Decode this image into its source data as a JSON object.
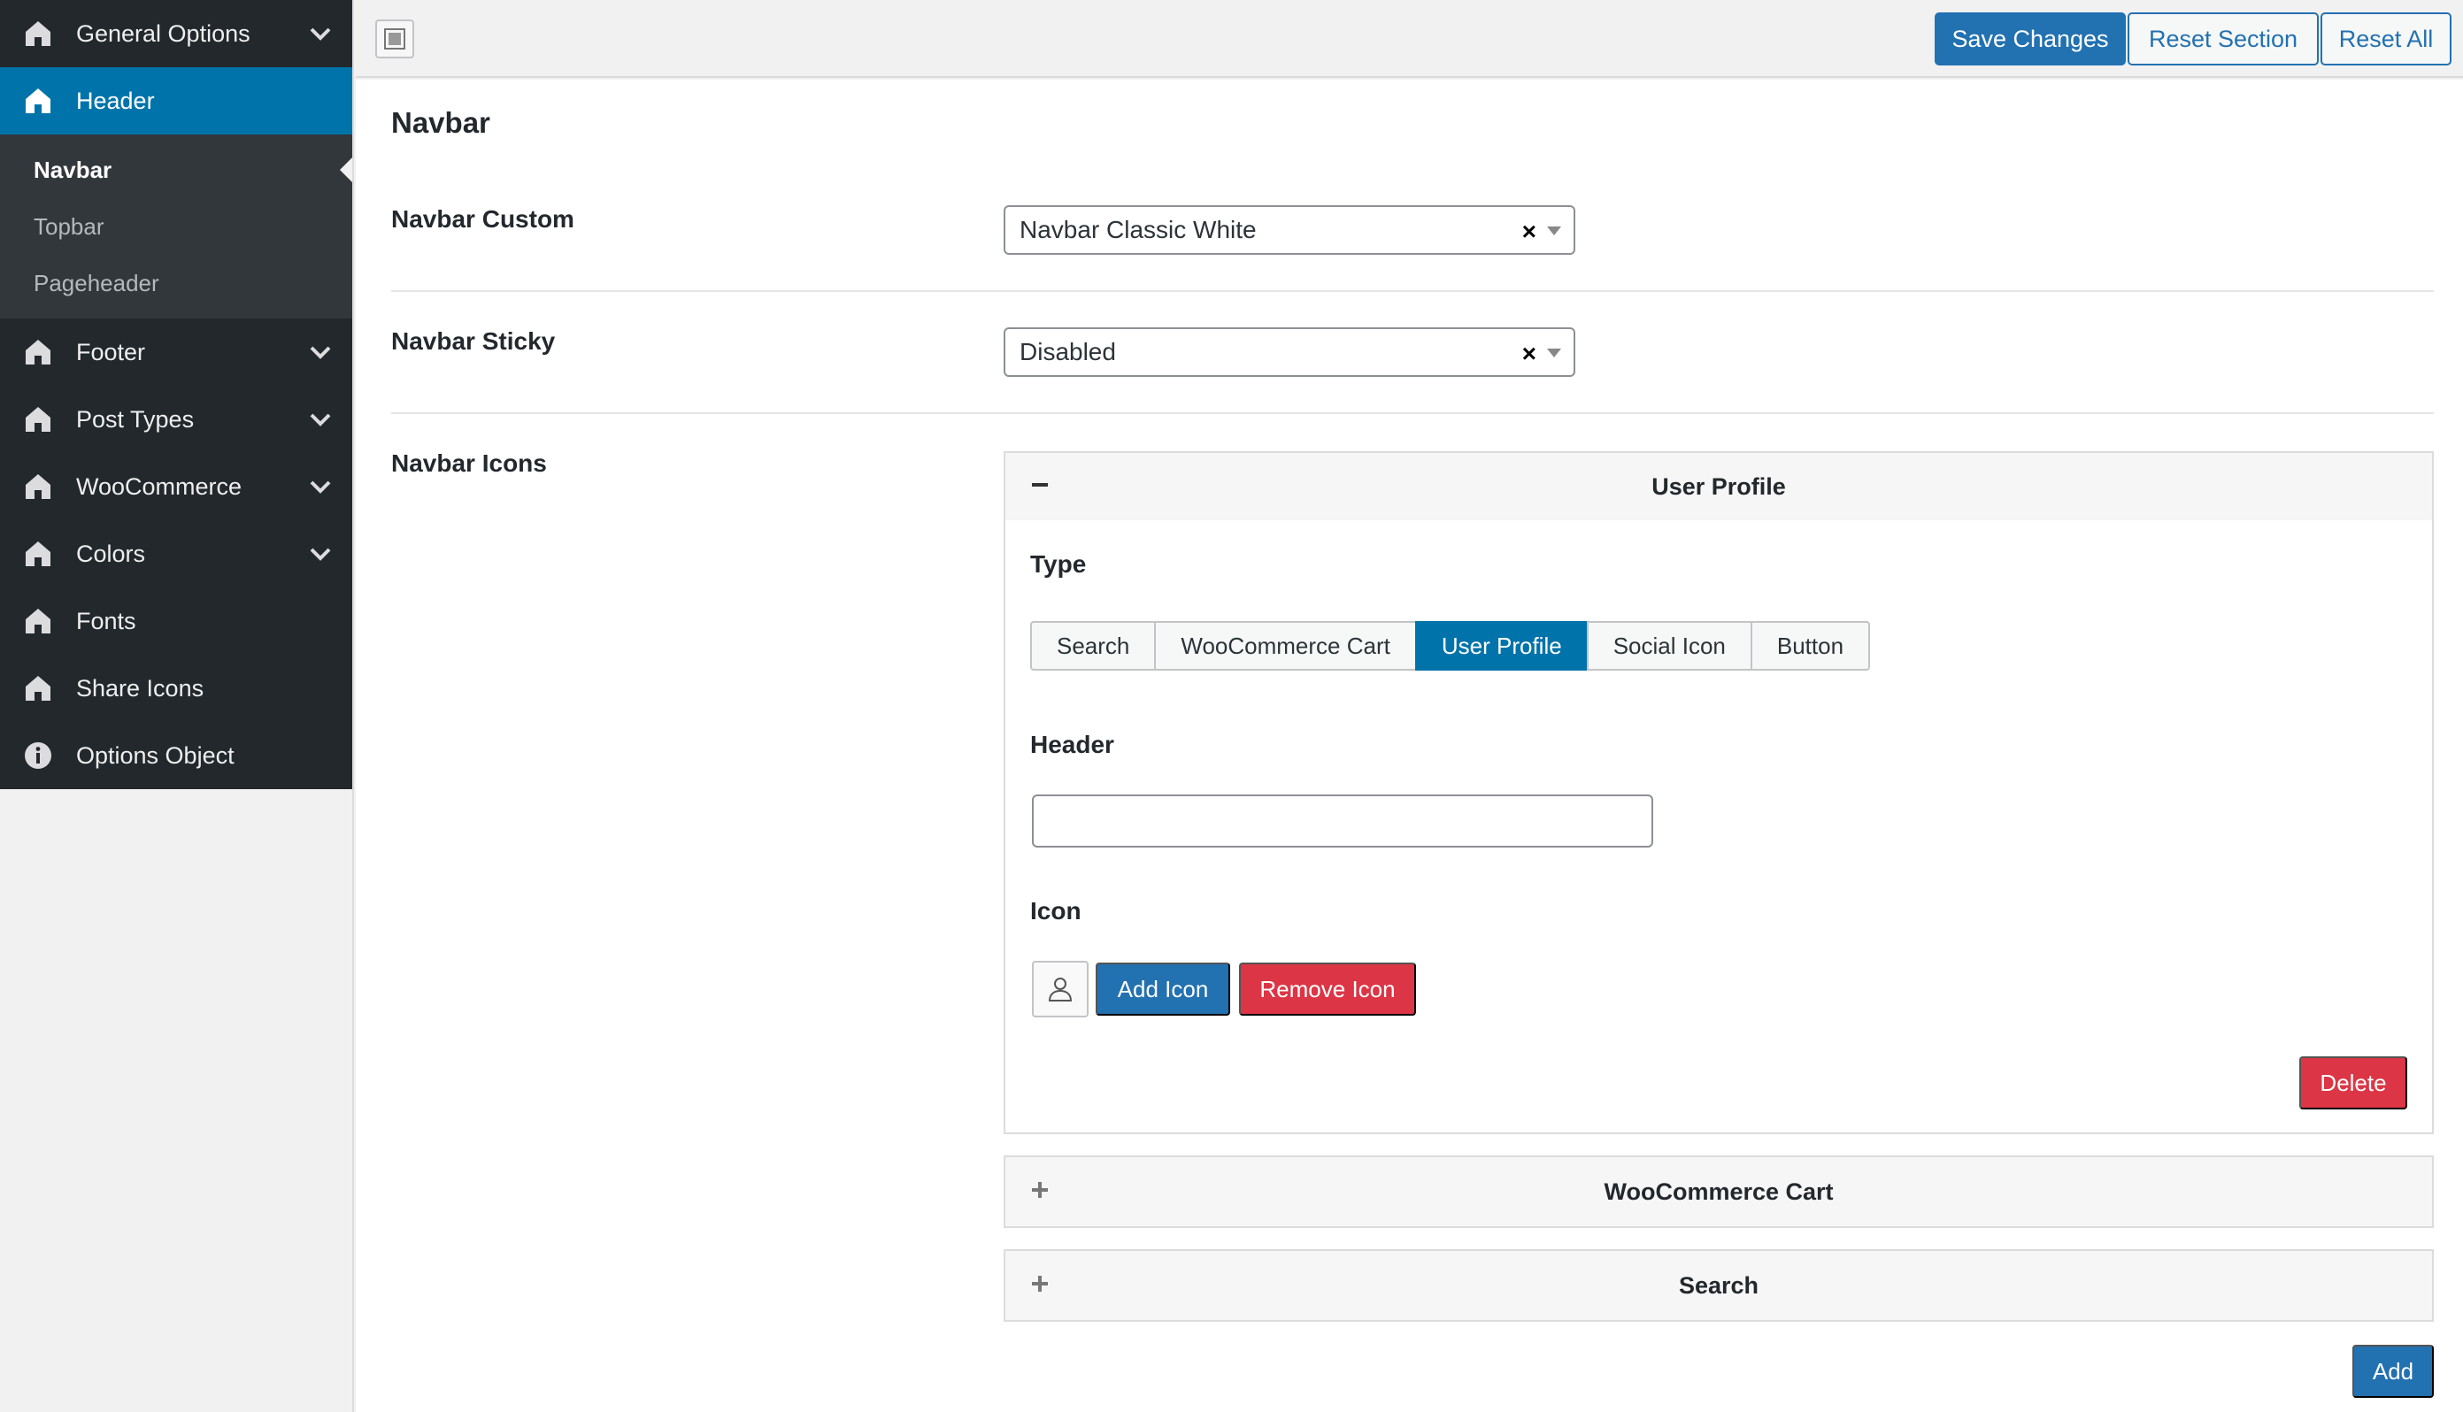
{
  "sidebar": {
    "items": [
      {
        "label": "General Options",
        "icon": "home-icon",
        "expandable": true
      },
      {
        "label": "Header",
        "icon": "home-icon",
        "active": true
      },
      {
        "label": "Footer",
        "icon": "home-icon",
        "expandable": true
      },
      {
        "label": "Post Types",
        "icon": "home-icon",
        "expandable": true
      },
      {
        "label": "WooCommerce",
        "icon": "home-icon",
        "expandable": true
      },
      {
        "label": "Colors",
        "icon": "home-icon",
        "expandable": true
      },
      {
        "label": "Fonts",
        "icon": "home-icon"
      },
      {
        "label": "Share Icons",
        "icon": "home-icon"
      },
      {
        "label": "Options Object",
        "icon": "info-icon"
      }
    ],
    "submenu": [
      {
        "label": "Navbar",
        "current": true
      },
      {
        "label": "Topbar"
      },
      {
        "label": "Pageheader"
      }
    ]
  },
  "toolbar": {
    "save_label": "Save Changes",
    "reset_section_label": "Reset Section",
    "reset_all_label": "Reset All"
  },
  "section": {
    "title": "Navbar"
  },
  "fields": {
    "navbar_custom": {
      "label": "Navbar Custom",
      "value": "Navbar Classic White"
    },
    "navbar_sticky": {
      "label": "Navbar Sticky",
      "value": "Disabled"
    },
    "navbar_icons": {
      "label": "Navbar Icons",
      "expanded_panel": {
        "title": "User Profile",
        "type_label": "Type",
        "type_options": [
          "Search",
          "WooCommerce Cart",
          "User Profile",
          "Social Icon",
          "Button"
        ],
        "type_selected": "User Profile",
        "header_label": "Header",
        "header_value": "",
        "icon_label": "Icon",
        "icon_preview": "user-icon",
        "add_icon_label": "Add Icon",
        "remove_icon_label": "Remove Icon",
        "delete_label": "Delete"
      },
      "collapsed_panels": [
        {
          "title": "WooCommerce Cart"
        },
        {
          "title": "Search"
        }
      ],
      "add_label": "Add"
    }
  },
  "colors": {
    "sidebar_bg": "#23282d",
    "submenu_bg": "#32373c",
    "accent": "#0073aa",
    "primary_button": "#2271b1",
    "danger_button": "#dc3545"
  }
}
